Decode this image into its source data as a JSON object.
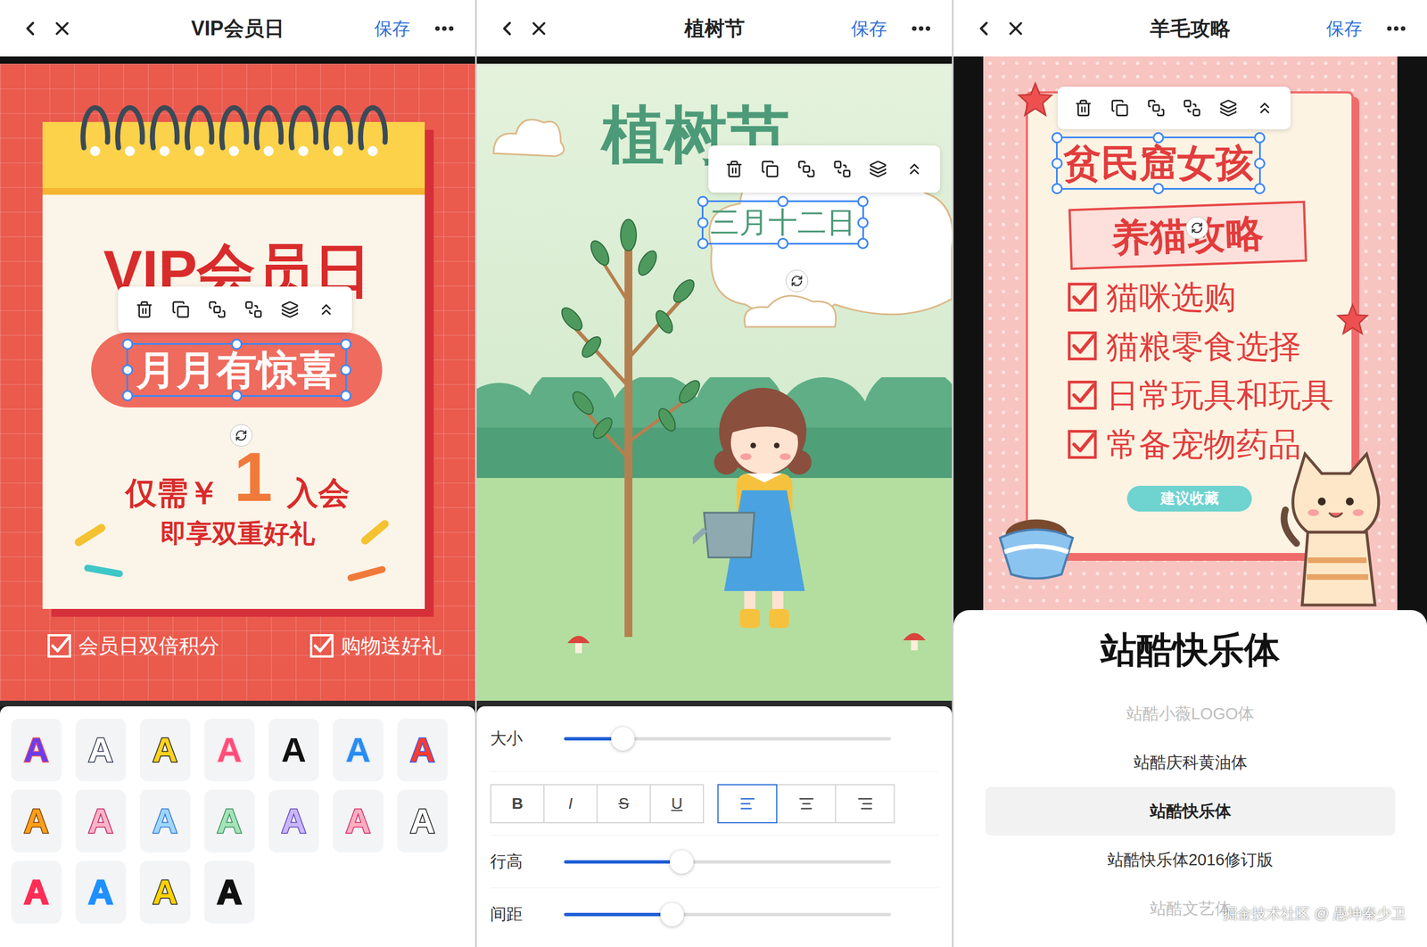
{
  "headers": [
    {
      "title": "VIP会员日",
      "save": "保存"
    },
    {
      "title": "植树节",
      "save": "保存"
    },
    {
      "title": "羊毛攻略",
      "save": "保存"
    }
  ],
  "vip_poster": {
    "title": "VIP会员日",
    "selected_text": "月月有惊喜",
    "price_prefix": "仅需￥",
    "price": "1",
    "price_suffix": "入会",
    "subtitle": "即享双重好礼",
    "perks": [
      {
        "label": "会员日双倍积分",
        "checked": true
      },
      {
        "label": "购物送好礼",
        "checked": true
      }
    ]
  },
  "style_panel": {
    "swatches": [
      {
        "text": "A",
        "color": "#6a3df0",
        "stroke": "#ff4d4d"
      },
      {
        "text": "A",
        "color": "#ffffff",
        "stroke": "#1f2a44"
      },
      {
        "text": "A",
        "color": "#ffd21f",
        "stroke": "#1a1a1a"
      },
      {
        "text": "A",
        "color": "#ff4d79",
        "stroke": "#ffd0dc"
      },
      {
        "text": "A",
        "color": "#111111",
        "stroke": "#ffffff"
      },
      {
        "text": "A",
        "color": "#2a8cf0",
        "stroke": "#cfe6ff"
      },
      {
        "text": "A",
        "color": "#ff3b30",
        "stroke": "#2e5bff"
      },
      {
        "text": "A",
        "color": "#ff9f1a",
        "stroke": "#7a3a00"
      },
      {
        "text": "A",
        "color": "#ffb3c8",
        "stroke": "#c2185b"
      },
      {
        "text": "A",
        "color": "#9fd6ff",
        "stroke": "#2a6fd6"
      },
      {
        "text": "A",
        "color": "#a5e3b8",
        "stroke": "#2e8b57"
      },
      {
        "text": "A",
        "color": "#c9b6ff",
        "stroke": "#5b3fb8"
      },
      {
        "text": "A",
        "color": "#ffb0c0",
        "stroke": "#d81b60"
      },
      {
        "text": "A",
        "color": "#ffffff",
        "stroke": "#111111"
      },
      {
        "text": "A",
        "color": "#ff2d55",
        "stroke": "#ff2d55"
      },
      {
        "text": "A",
        "color": "#1e90ff",
        "stroke": "#1e90ff"
      },
      {
        "text": "A",
        "color": "#ffd200",
        "stroke": "#222222"
      },
      {
        "text": "A",
        "color": "#111111",
        "stroke": "#111111"
      }
    ]
  },
  "arbor_poster": {
    "title": "植树节",
    "selected_text": "三月十二日"
  },
  "text_panel": {
    "sliders": [
      {
        "label": "大小",
        "level": 0.18
      },
      {
        "label": "行高",
        "level": 0.36
      },
      {
        "label": "间距",
        "level": 0.33
      }
    ],
    "format_buttons": [
      {
        "label": "B",
        "kind": "bold",
        "selected": false
      },
      {
        "label": "I",
        "kind": "italic",
        "selected": false
      },
      {
        "label": "S",
        "kind": "strike",
        "selected": false
      },
      {
        "label": "U",
        "kind": "underline",
        "selected": false
      }
    ],
    "align_buttons": [
      {
        "kind": "left",
        "selected": true
      },
      {
        "kind": "center",
        "selected": false
      },
      {
        "kind": "right",
        "selected": false
      }
    ]
  },
  "cat_poster": {
    "selected_text": "贫民窟女孩",
    "subtitle": "养猫攻略",
    "checklist": [
      {
        "label": "猫咪选购",
        "checked": true
      },
      {
        "label": "猫粮零食选择",
        "checked": true
      },
      {
        "label": "日常玩具和玩具",
        "checked": true
      },
      {
        "label": "常备宠物药品",
        "checked": true
      }
    ],
    "badge": "建议收藏"
  },
  "font_sheet": {
    "current": "站酷快乐体",
    "options": [
      {
        "label": "站酷小薇LOGO体",
        "selected": false,
        "faded": true
      },
      {
        "label": "站酷庆科黄油体",
        "selected": false,
        "faded": false
      },
      {
        "label": "站酷快乐体",
        "selected": true,
        "faded": false
      },
      {
        "label": "站酷快乐体2016修订版",
        "selected": false,
        "faded": false
      },
      {
        "label": "站酷文艺体",
        "selected": false,
        "faded": true
      }
    ]
  },
  "watermark": "掘金技术社区 @ 愚坤秦少卫"
}
